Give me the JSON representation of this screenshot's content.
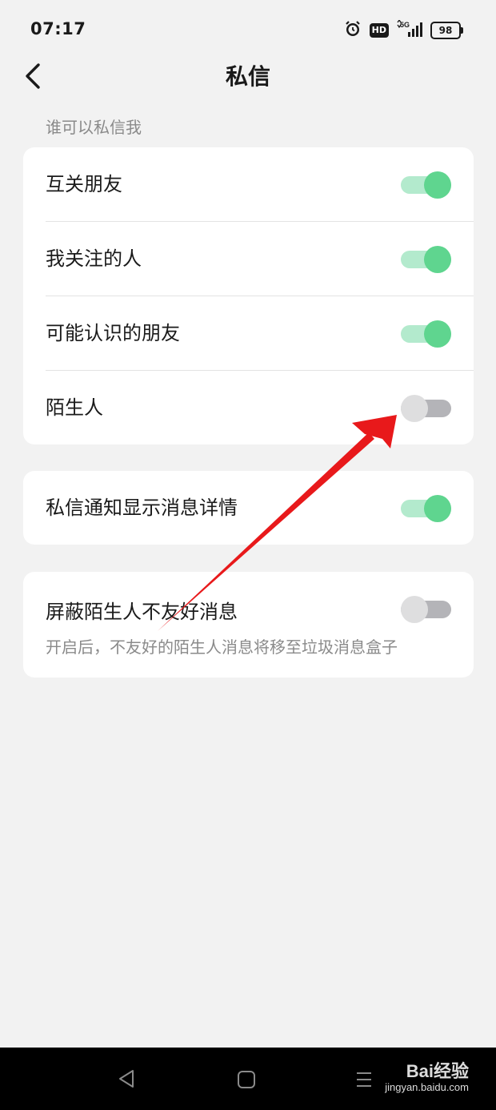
{
  "status_bar": {
    "time": "07:17",
    "hd": "HD",
    "network": "5G",
    "battery": "98"
  },
  "header": {
    "title": "私信"
  },
  "section": {
    "label": "谁可以私信我"
  },
  "group1": {
    "items": [
      {
        "label": "互关朋友",
        "on": true
      },
      {
        "label": "我关注的人",
        "on": true
      },
      {
        "label": "可能认识的朋友",
        "on": true
      },
      {
        "label": "陌生人",
        "on": false
      }
    ]
  },
  "group2": {
    "label": "私信通知显示消息详情",
    "on": true
  },
  "group3": {
    "label": "屏蔽陌生人不友好消息",
    "sub": "开启后，不友好的陌生人消息将移至垃圾消息盒子",
    "on": false
  },
  "watermark": {
    "logo": "Bai经验",
    "url": "jingyan.baidu.com"
  },
  "colors": {
    "toggle_on": "#5fd58f",
    "toggle_on_track": "#b3eacd",
    "toggle_off": "#dededf",
    "annotation_arrow": "#e8191b"
  }
}
